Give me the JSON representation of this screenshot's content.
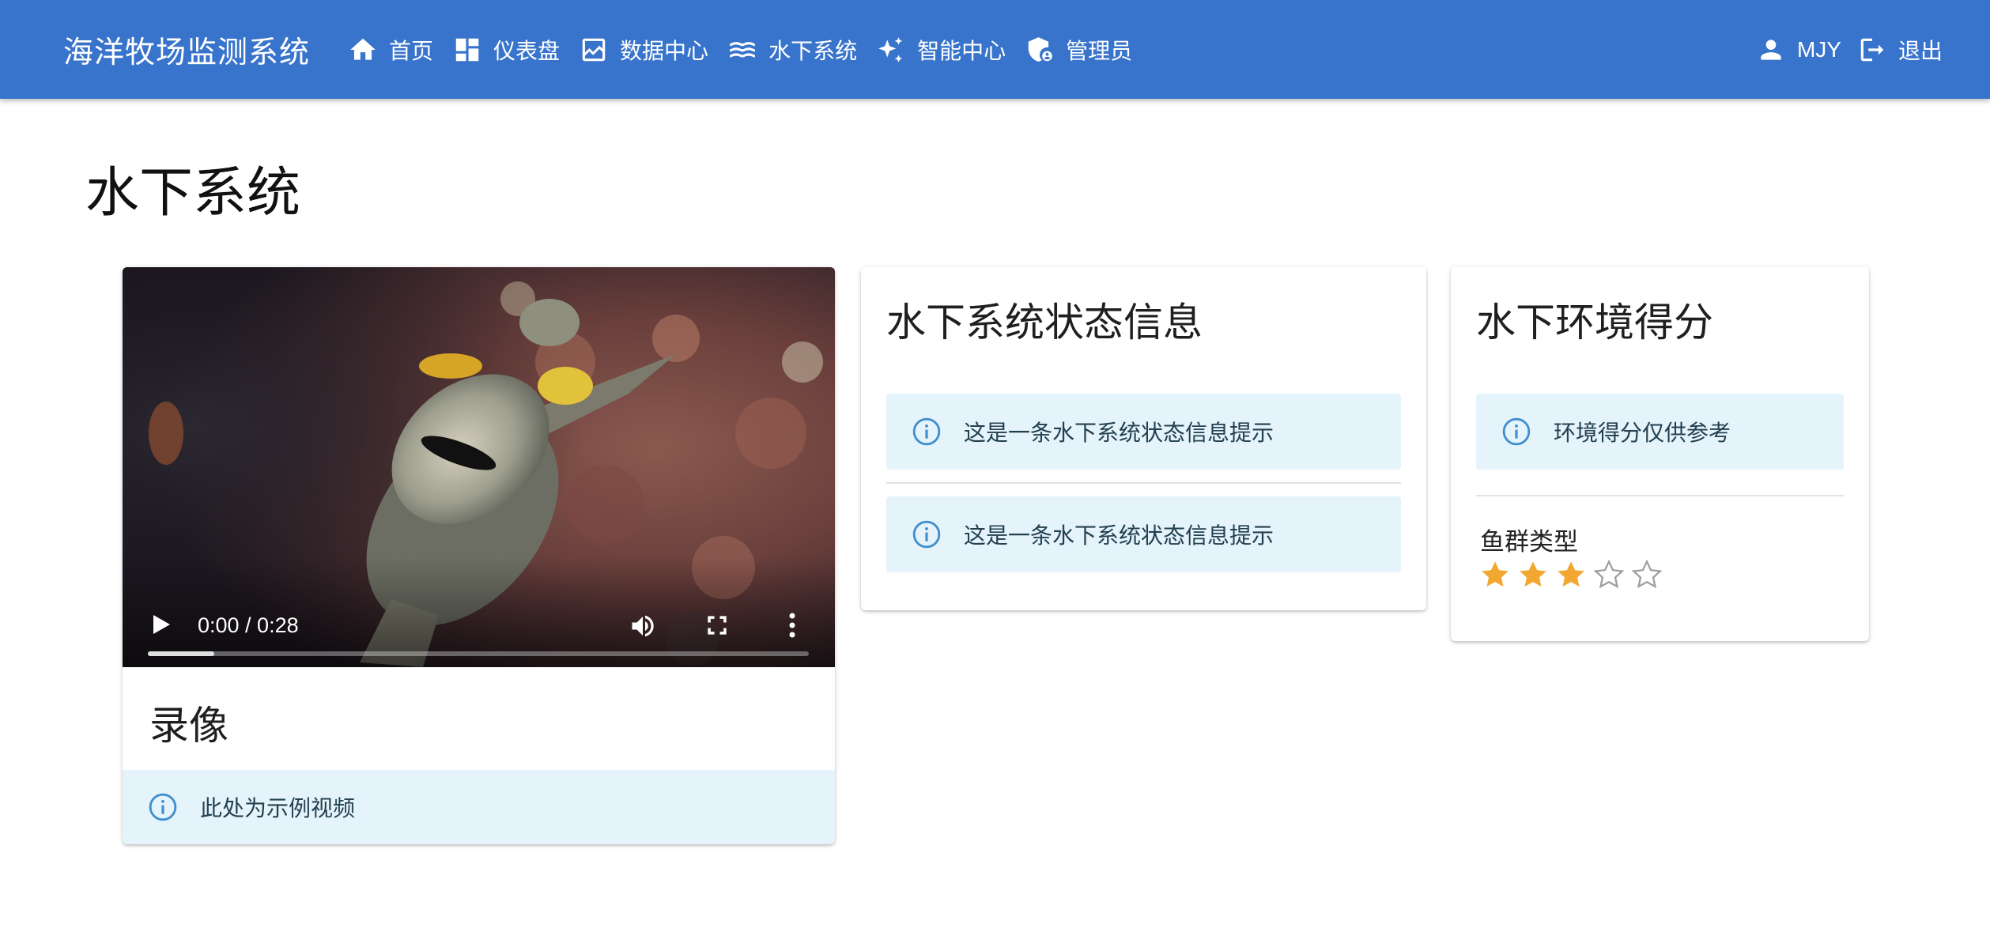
{
  "app": {
    "title": "海洋牧场监测系统",
    "accent_color": "#3874cb",
    "alert_bg": "#e5f3fb",
    "star_color": "#f2a731"
  },
  "nav": {
    "items": [
      {
        "label": "首页",
        "icon": "home-icon"
      },
      {
        "label": "仪表盘",
        "icon": "dashboard-icon"
      },
      {
        "label": "数据中心",
        "icon": "chart-icon"
      },
      {
        "label": "水下系统",
        "icon": "waves-icon"
      },
      {
        "label": "智能中心",
        "icon": "sparkle-icon"
      },
      {
        "label": "管理员",
        "icon": "admin-shield-icon"
      }
    ],
    "user": {
      "label": "MJY",
      "icon": "person-icon"
    },
    "logout": {
      "label": "退出",
      "icon": "logout-icon"
    }
  },
  "page": {
    "title": "水下系统"
  },
  "video_card": {
    "time": "0:00 / 0:28",
    "progress_fraction": 0.1,
    "title": "录像",
    "alert": "此处为示例视频"
  },
  "status_card": {
    "title": "水下系统状态信息",
    "alerts": [
      "这是一条水下系统状态信息提示",
      "这是一条水下系统状态信息提示"
    ]
  },
  "score_card": {
    "title": "水下环境得分",
    "alert": "环境得分仅供参考",
    "rating_label": "鱼群类型",
    "rating": 3,
    "rating_max": 5
  }
}
